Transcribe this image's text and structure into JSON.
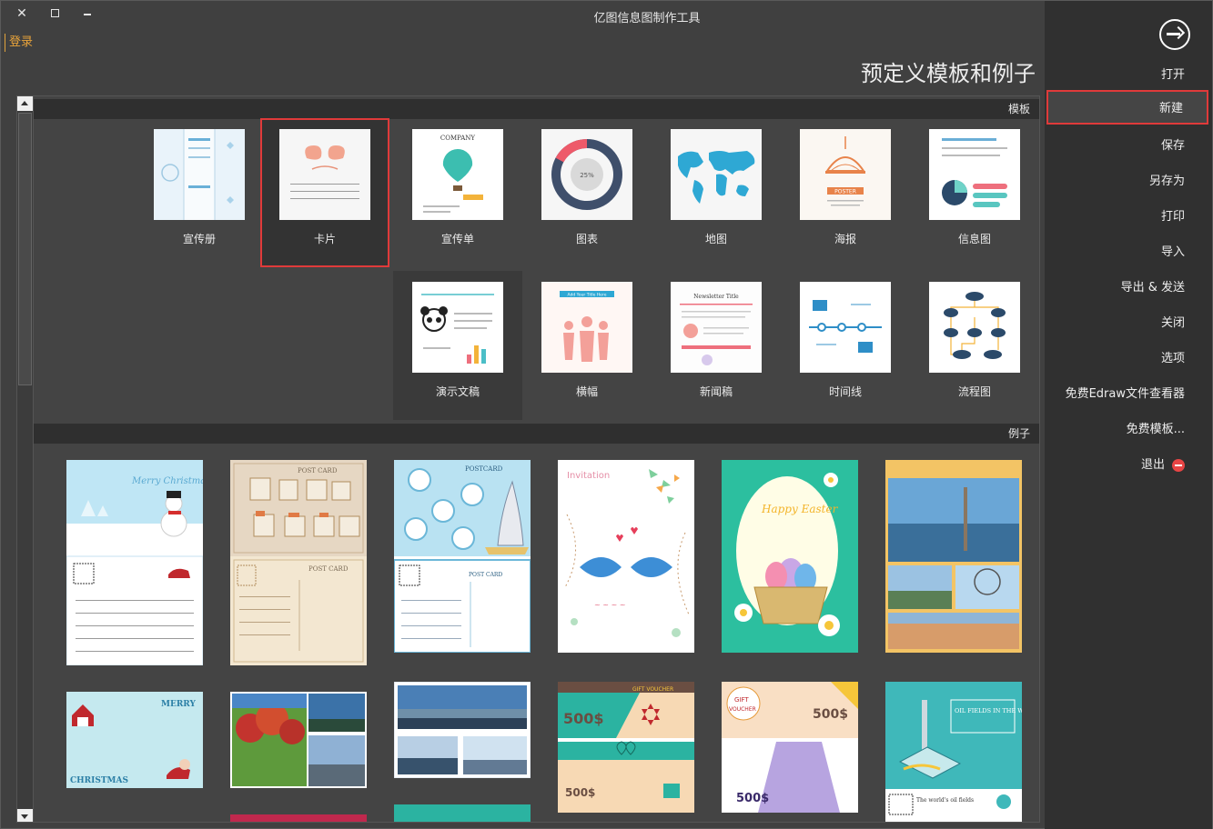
{
  "window": {
    "title": "亿图信息图制作工具",
    "close_glyph": "✕",
    "login": "登录"
  },
  "page_title": "预定义模板和例子",
  "menu": {
    "items": [
      {
        "label": "打开"
      },
      {
        "label": "新建"
      },
      {
        "label": "保存"
      },
      {
        "label": "另存为"
      },
      {
        "label": "打印"
      },
      {
        "label": "导入"
      },
      {
        "label": "导出 & 发送"
      },
      {
        "label": "关闭"
      },
      {
        "label": "选项"
      },
      {
        "label": "免费Edraw文件查看器"
      },
      {
        "label": "免费模板..."
      },
      {
        "label": "退出"
      }
    ],
    "selected": "新建",
    "exit_icon": "exit-icon",
    "open_icon": "arrow-right-circle-icon"
  },
  "templates": {
    "header": "模板",
    "items": [
      {
        "label": "宣传册"
      },
      {
        "label": "卡片"
      },
      {
        "label": "宣传单"
      },
      {
        "label": "图表"
      },
      {
        "label": "地图"
      },
      {
        "label": "海报"
      },
      {
        "label": "信息图"
      },
      {
        "label": "演示文稿"
      },
      {
        "label": "横幅"
      },
      {
        "label": "新闻稿"
      },
      {
        "label": "时间线"
      },
      {
        "label": "流程图"
      }
    ],
    "selected": "卡片"
  },
  "thumb_text": {
    "company": "COMPANY",
    "poster": "POSTER",
    "lorem": "LOREM",
    "pct": "25%",
    "add_title": "Add Your Title Here",
    "news_title": "Newsletter Title"
  },
  "examples": {
    "header": "例子",
    "text": {
      "merry_christmas": "Merry Christmas",
      "post_card": "POST CARD",
      "postcard": "POSTCARD",
      "invitation": "Invitation",
      "happy_easter": "Happy Easter",
      "merry": "MERRY",
      "christmas": "CHRISTMAS",
      "gift_voucher": "GIFT VOUCHER",
      "gift": "GIFT",
      "voucher": "VOUCHER",
      "price": "500$",
      "oil_fields": "OIL FIELDS IN THE WORLD",
      "worlds_oil": "The world's oil fields"
    }
  },
  "colors": {
    "accent_red": "#e03a3a",
    "login_orange": "#e8a33a",
    "panel_dark": "#303030",
    "bg": "#404040"
  }
}
